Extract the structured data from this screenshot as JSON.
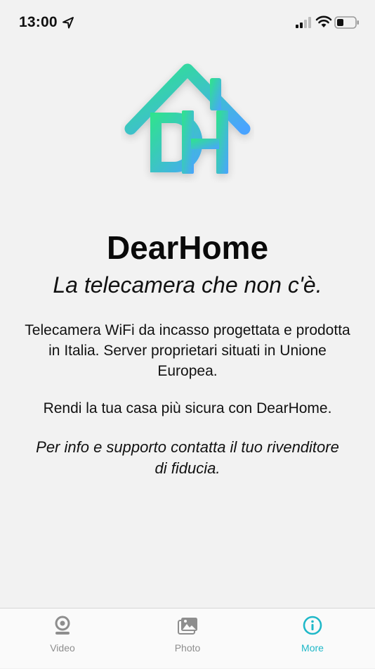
{
  "status_bar": {
    "time": "13:00",
    "icons": [
      "location-arrow-icon",
      "cellular-signal-icon",
      "wifi-icon",
      "battery-icon"
    ]
  },
  "logo": {
    "icon": "dearhome-house-logo",
    "letters": "DH",
    "gradient_start": "#2ee58a",
    "gradient_end": "#4aa3ff"
  },
  "content": {
    "title": "DearHome",
    "tagline": "La telecamera che non c'è.",
    "description": "Telecamera WiFi da incasso progettata e prodotta in Italia. Server proprietari situati in Unione Europea.",
    "promo": "Rendi la tua casa più sicura con DearHome.",
    "support": "Per info e supporto contatta il tuo rivenditore di fiducia."
  },
  "tab_bar": {
    "active_color": "#1fb8c8",
    "inactive_color": "#8e8e8e",
    "items": [
      {
        "label": "Video",
        "icon": "webcam-icon",
        "active": false
      },
      {
        "label": "Photo",
        "icon": "photo-gallery-icon",
        "active": false
      },
      {
        "label": "More",
        "icon": "info-icon",
        "active": true
      }
    ]
  }
}
